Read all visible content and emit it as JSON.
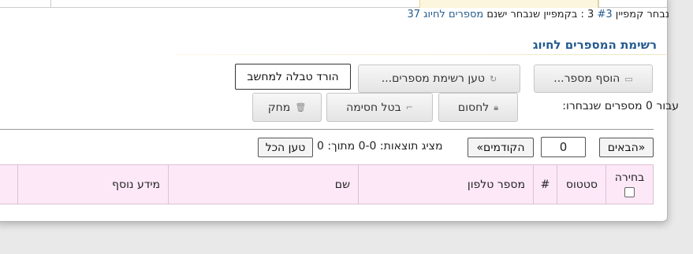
{
  "info": {
    "prefix": "נבחר קמפיין",
    "campaign_id": "#3",
    "campaign_num": "3",
    "middle": ": בקמפיין שנבחר ישנם",
    "count_link": "מספרים לחיוג 37"
  },
  "section_title": "רשימת המספרים לחיוג",
  "toolbar": {
    "add_number": "הוסף מספר...",
    "load_list": "טען רשימת מספרים...",
    "download_table": "הורד טבלה למחשב"
  },
  "selection": {
    "label": "עבור 0 מספרים שנבחרו:",
    "block": "לחסום",
    "unblock": "בטל חסימה",
    "delete": "מחק"
  },
  "pager": {
    "next": "«הבאים",
    "page_value": "0",
    "prev": "הקודמים»",
    "showing": "מציג תוצאות: 0-0 מתוך: 0",
    "load_all": "טען הכל"
  },
  "table": {
    "headers": {
      "select": "בחירה",
      "status": "סטטוס",
      "index": "#",
      "phone": "מספר טלפון",
      "name": "שם",
      "extra": "מידע נוסף"
    }
  },
  "colors": {
    "link": "#245b8f",
    "header_bg": "#fde8f8",
    "tab_active_bg": "#fbf6dc"
  }
}
